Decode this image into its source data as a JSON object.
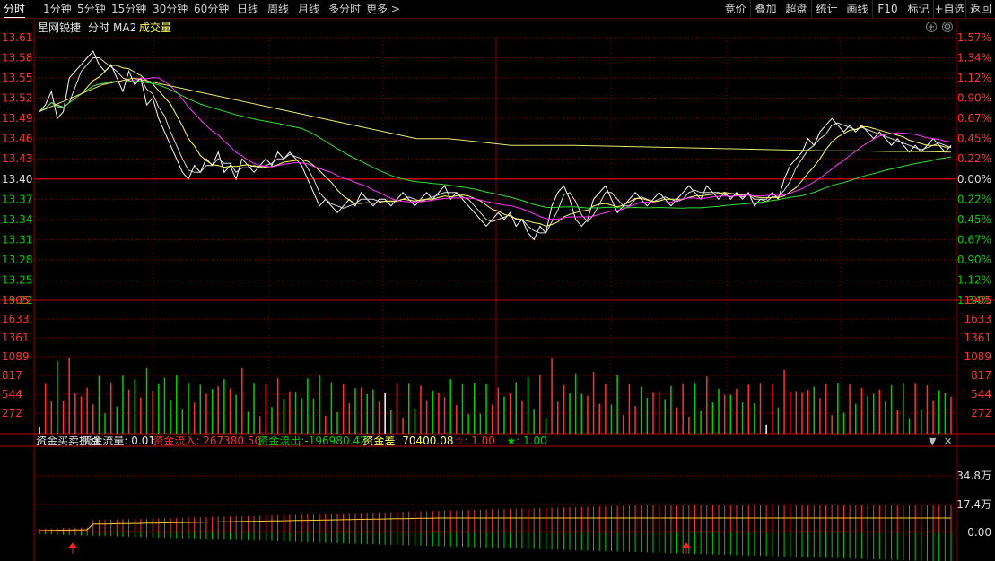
{
  "tabs": [
    "分时",
    "1分钟",
    "5分钟",
    "15分钟",
    "30分钟",
    "60分钟",
    "日线",
    "周线",
    "月线",
    "多分时",
    "更多 >"
  ],
  "right_buttons": [
    "竞价",
    "叠加",
    "超盘",
    "统计",
    "画线",
    "F10",
    "标记",
    "+自选",
    "返回"
  ],
  "main_header": {
    "stock_name": "星网锐捷",
    "mode": "分时",
    "ma": "MA2",
    "volume_label": "成交量"
  },
  "price_axis": {
    "left": [
      "13.61",
      "13.58",
      "13.55",
      "13.52",
      "13.49",
      "13.46",
      "13.43",
      "13.40",
      "13.37",
      "13.34",
      "13.31",
      "13.28",
      "13.25",
      "13.22"
    ],
    "right": [
      "1.57%",
      "1.34%",
      "1.12%",
      "0.90%",
      "0.67%",
      "0.45%",
      "0.22%",
      "0.00%",
      "0.22%",
      "0.45%",
      "0.67%",
      "0.90%",
      "1.12%",
      "1.34%"
    ]
  },
  "volume_axis": [
    "1905",
    "1633",
    "1361",
    "1089",
    "817",
    "544",
    "272"
  ],
  "sub_panel": {
    "name": "资金买卖抓涨",
    "flow_label": "资金流量:",
    "flow_value": "0.01",
    "inflow_label": "资金流入:",
    "inflow_value": "267380.50",
    "outflow_label": "资金流出:",
    "outflow_value": "-196980.42",
    "diff_label": "资金差:",
    "diff_value": "70400.08",
    "star_red": "☆: 1.00",
    "star_green": "★: 1.00",
    "axis": [
      "34.8万",
      "17.4万",
      "0.00"
    ]
  },
  "colors": {
    "up": "#ff3232",
    "down": "#00d000",
    "price_line": "#ffffff",
    "avg_line": "#ffff66",
    "ma_magenta": "#ff33ff",
    "ma_green": "#33dd33",
    "grid": "#8b0000"
  },
  "chart_data": {
    "type": "line",
    "title": "星网锐捷 分时",
    "ylim": [
      13.22,
      13.61
    ],
    "prev_close": 13.4,
    "series": [
      {
        "name": "price",
        "values": [
          13.5,
          13.51,
          13.53,
          13.49,
          13.5,
          13.55,
          13.56,
          13.57,
          13.58,
          13.59,
          13.57,
          13.56,
          13.57,
          13.55,
          13.53,
          13.56,
          13.54,
          13.55,
          13.51,
          13.52,
          13.49,
          13.47,
          13.45,
          13.43,
          13.41,
          13.4,
          13.42,
          13.41,
          13.43,
          13.42,
          13.44,
          13.41,
          13.42,
          13.4,
          13.43,
          13.42,
          13.41,
          13.42,
          13.43,
          13.42,
          13.44,
          13.43,
          13.44,
          13.43,
          13.42,
          13.4,
          13.38,
          13.36,
          13.37,
          13.36,
          13.35,
          13.36,
          13.37,
          13.36,
          13.38,
          13.37,
          13.36,
          13.37,
          13.37,
          13.36,
          13.37,
          13.38,
          13.37,
          13.36,
          13.37,
          13.38,
          13.37,
          13.38,
          13.39,
          13.37,
          13.38,
          13.37,
          13.36,
          13.35,
          13.34,
          13.33,
          13.34,
          13.35,
          13.34,
          13.35,
          13.33,
          13.34,
          13.32,
          13.31,
          13.33,
          13.32,
          13.36,
          13.38,
          13.39,
          13.37,
          13.34,
          13.33,
          13.34,
          13.37,
          13.38,
          13.39,
          13.37,
          13.35,
          13.36,
          13.37,
          13.38,
          13.37,
          13.36,
          13.37,
          13.38,
          13.37,
          13.36,
          13.37,
          13.38,
          13.39,
          13.38,
          13.37,
          13.39,
          13.38,
          13.37,
          13.38,
          13.37,
          13.38,
          13.37,
          13.38,
          13.36,
          13.37,
          13.37,
          13.38,
          13.37,
          13.4,
          13.42,
          13.43,
          13.44,
          13.46,
          13.45,
          13.47,
          13.48,
          13.49,
          13.48,
          13.47,
          13.48,
          13.47,
          13.48,
          13.47,
          13.46,
          13.47,
          13.46,
          13.45,
          13.46,
          13.45,
          13.44,
          13.45,
          13.44,
          13.45,
          13.46,
          13.45,
          13.44,
          13.45
        ]
      },
      {
        "name": "MA2",
        "values": [
          13.5,
          13.52,
          13.54,
          13.55,
          13.54,
          13.53,
          13.52,
          13.51,
          13.5,
          13.49,
          13.48,
          13.47,
          13.46,
          13.46,
          13.455,
          13.45,
          13.45,
          13.45,
          13.449,
          13.448,
          13.447,
          13.446,
          13.445,
          13.444,
          13.443,
          13.442,
          13.442,
          13.441,
          13.441,
          13.44
        ]
      }
    ]
  }
}
